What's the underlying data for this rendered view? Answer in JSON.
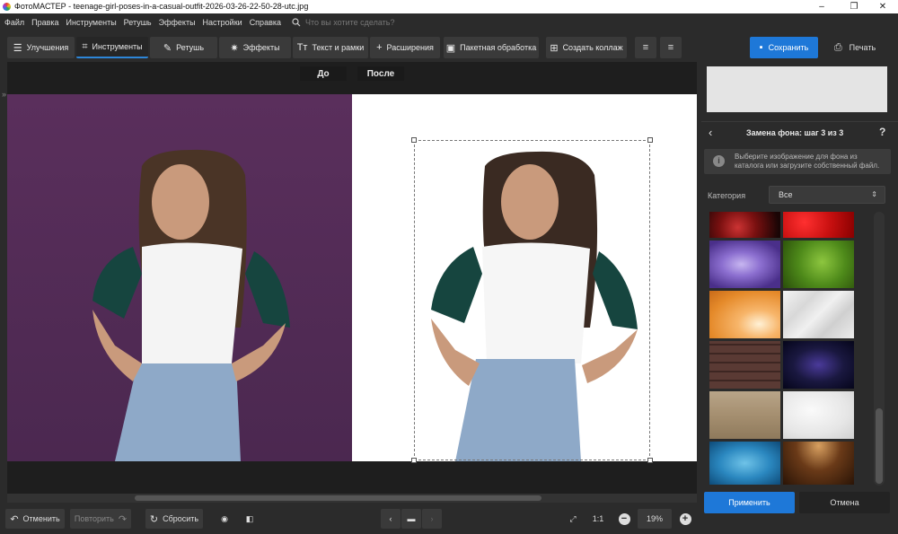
{
  "window": {
    "title": "ФотоМАСТЕР - teenage-girl-poses-in-a-casual-outfit-2026-03-26-22-50-28-utc.jpg",
    "minimize": "–",
    "maximize": "❐",
    "close": "✕"
  },
  "menu": {
    "items": [
      "Файл",
      "Правка",
      "Инструменты",
      "Ретушь",
      "Эффекты",
      "Настройки",
      "Справка"
    ],
    "search_placeholder": "Что вы хотите сделать?"
  },
  "toolbar": {
    "tabs": [
      "Улучшения",
      "Инструменты",
      "Ретушь",
      "Эффекты",
      "Текст и рамки",
      "Расширения"
    ],
    "active_tab": "Инструменты",
    "batch_label": "Пакетная обработка",
    "collage_label": "Создать коллаж",
    "save_label": "Сохранить",
    "print_label": "Печать"
  },
  "compare": {
    "before": "До",
    "after": "После"
  },
  "bottom": {
    "undo": "Отменить",
    "redo": "Повторить",
    "reset": "Сбросить",
    "ratio": "1:1",
    "zoom": "19%"
  },
  "panel": {
    "step_title": "Замена фона: шаг 3 из 3",
    "help": "?",
    "info_text": "Выберите изображение для фона из каталога или загрузите собственный файл.",
    "category_label": "Категория",
    "category_value": "Все",
    "thumbnails": [
      "red-flower-bg",
      "red-flower-drops-bg",
      "purple-flower-bg",
      "green-leaf-drops-bg",
      "orange-petals-bg",
      "crumpled-paper-bg",
      "brick-wall-bg",
      "starry-sky-bg",
      "burlap-texture-bg",
      "white-marble-bg",
      "blue-water-bg",
      "wood-spotlight-bg"
    ],
    "apply": "Применить",
    "cancel": "Отмена"
  }
}
